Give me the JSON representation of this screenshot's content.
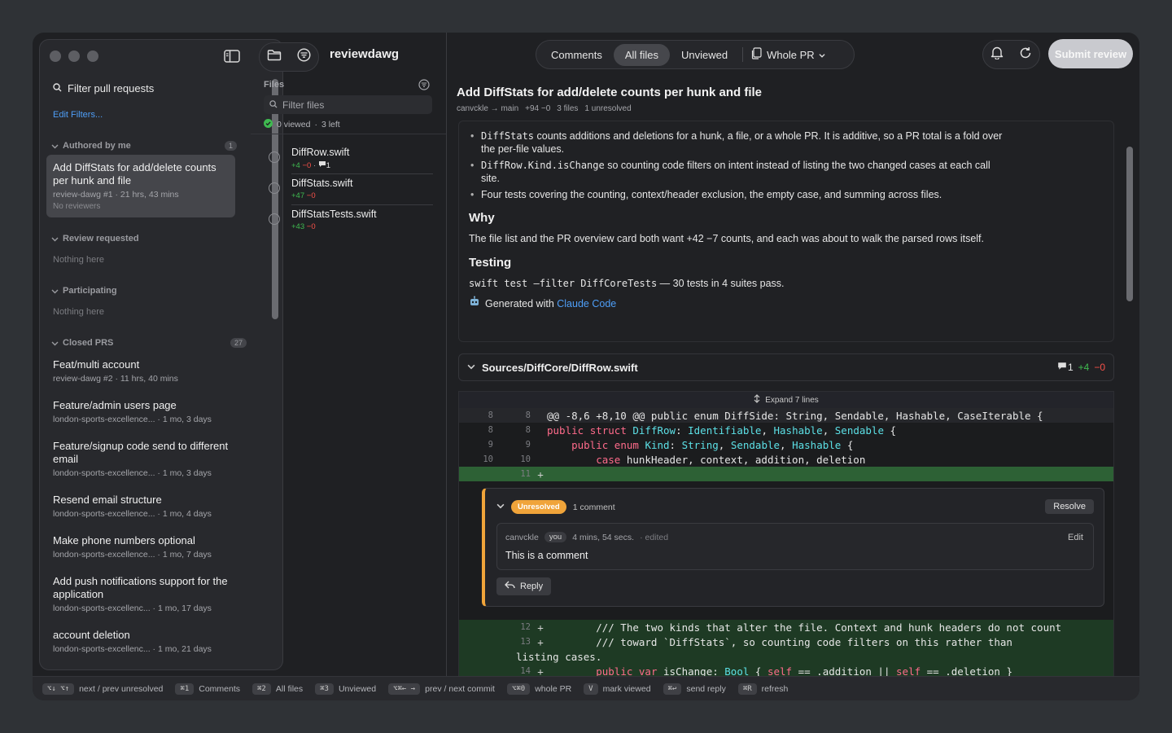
{
  "sidebar": {
    "filter_placeholder": "Filter pull requests",
    "edit_filters": "Edit Filters...",
    "authored": {
      "label": "Authored by me",
      "count": "1"
    },
    "review_requested": {
      "label": "Review requested",
      "empty": "Nothing here"
    },
    "participating": {
      "label": "Participating",
      "empty": "Nothing here"
    },
    "closed": {
      "label": "Closed PRS",
      "count": "27"
    },
    "selected_pr": {
      "title": "Add DiffStats for add/delete counts per hunk and file",
      "meta": "review-dawg #1 · 21 hrs, 43 mins",
      "reviewers": "No reviewers"
    },
    "closed_items": [
      {
        "title": "Feat/multi account",
        "meta": "review-dawg #2 · 11 hrs, 40 mins"
      },
      {
        "title": "Feature/admin users page",
        "meta": "london-sports-excellence... · 1 mo, 3 days"
      },
      {
        "title": "Feature/signup code send to different email",
        "meta": "london-sports-excellence... · 1 mo, 3 days"
      },
      {
        "title": "Resend email structure",
        "meta": "london-sports-excellence... · 1 mo, 4 days"
      },
      {
        "title": "Make phone numbers optional",
        "meta": "london-sports-excellence... · 1 mo, 7 days"
      },
      {
        "title": "Add push notifications support for the application",
        "meta": "london-sports-excellenc... · 1 mo, 17 days"
      },
      {
        "title": "account deletion",
        "meta": "london-sports-excellenc... · 1 mo, 21 days"
      }
    ]
  },
  "files": {
    "app_name": "reviewdawg",
    "label": "Files",
    "filter_placeholder": "Filter files",
    "viewed": "0 viewed",
    "left": "3 left",
    "items": [
      {
        "name": "DiffRow.swift",
        "add": "+4",
        "del": "−0",
        "comments": "1"
      },
      {
        "name": "DiffStats.swift",
        "add": "+47",
        "del": "−0"
      },
      {
        "name": "DiffStatsTests.swift",
        "add": "+43",
        "del": "−0"
      }
    ]
  },
  "toolbar": {
    "tabs": [
      "Comments",
      "All files",
      "Unviewed"
    ],
    "active_tab": "All files",
    "scope": "Whole PR",
    "submit": "Submit review"
  },
  "pr": {
    "title": "Add DiffStats for add/delete counts per hunk and file",
    "branch": "canvckle → main",
    "changes": "+94 −0",
    "files": "3 files",
    "unresolved": "1 unresolved"
  },
  "description": {
    "bullets": [
      {
        "code": "DiffStats",
        "text": " counts additions and deletions for a hunk, a file, or a whole PR. It is additive, so a PR total is a fold over the per-file values."
      },
      {
        "code": "DiffRow.Kind.isChange",
        "text": " so counting code filters on intent instead of listing the two changed cases at each call site."
      },
      {
        "code": "",
        "text": "Four tests covering the counting, context/header exclusion, the empty case, and summing across files."
      }
    ],
    "why_heading": "Why",
    "why_text": "The file list and the PR overview card both want +42  −7 counts, and each was about to walk the parsed rows itself.",
    "testing_heading": "Testing",
    "testing_code": "swift test —filter DiffCoreTests",
    "testing_text": " — 30 tests in 4 suites pass.",
    "generated_prefix": "Generated with ",
    "generated_link": "Claude Code"
  },
  "diff": {
    "path": "Sources/DiffCore/DiffRow.swift",
    "comment_count": "1",
    "add": "+4",
    "del": "−0",
    "expand": "Expand 7 lines",
    "lines": [
      {
        "n1": "8",
        "n2": "8",
        "pm": "",
        "text": "@@ -8,6 +8,10 @@ public enum DiffSide: String, Sendable, Hashable, CaseIterable {"
      },
      {
        "n1": "8",
        "n2": "8",
        "pm": "",
        "text": "public struct DiffRow: Identifiable, Hashable, Sendable {"
      },
      {
        "n1": "9",
        "n2": "9",
        "pm": "",
        "text": "    public enum Kind: String, Sendable, Hashable {"
      },
      {
        "n1": "10",
        "n2": "10",
        "pm": "",
        "text": "        case hunkHeader, context, addition, deletion"
      },
      {
        "n1": "",
        "n2": "11",
        "pm": "+",
        "text": ""
      },
      {
        "n1": "",
        "n2": "12",
        "pm": "+",
        "text": "        /// The two kinds that alter the file. Context and hunk headers do not count"
      },
      {
        "n1": "",
        "n2": "13",
        "pm": "+",
        "text": "        /// toward `DiffStats`, so counting code filters on this rather than"
      },
      {
        "n1": "",
        "n2": "",
        "pm": "",
        "text": "listing cases."
      },
      {
        "n1": "",
        "n2": "14",
        "pm": "+",
        "text": "        public var isChange: Bool { self == .addition || self == .deletion }"
      }
    ]
  },
  "thread": {
    "status": "Unresolved",
    "count": "1 comment",
    "resolve": "Resolve",
    "author": "canvckle",
    "you": "you",
    "time": "4 mins, 54 secs.",
    "edited": "· edited",
    "edit": "Edit",
    "body": "This is a comment",
    "reply": "Reply"
  },
  "shortcuts": [
    {
      "keys": "⌥↓ ⌥↑",
      "label": "next / prev unresolved"
    },
    {
      "keys": "⌘1",
      "label": "Comments"
    },
    {
      "keys": "⌘2",
      "label": "All files"
    },
    {
      "keys": "⌘3",
      "label": "Unviewed"
    },
    {
      "keys": "⌥⌘← →",
      "label": "prev / next commit"
    },
    {
      "keys": "⌥⌘0",
      "label": "whole PR"
    },
    {
      "keys": "V",
      "label": "mark viewed"
    },
    {
      "keys": "⌘↩",
      "label": "send reply"
    },
    {
      "keys": "⌘R",
      "label": "refresh"
    }
  ],
  "colors": {
    "accent": "#4e9ef7",
    "addition": "#3fb950",
    "deletion": "#f85149",
    "unresolved": "#f0a43a"
  }
}
